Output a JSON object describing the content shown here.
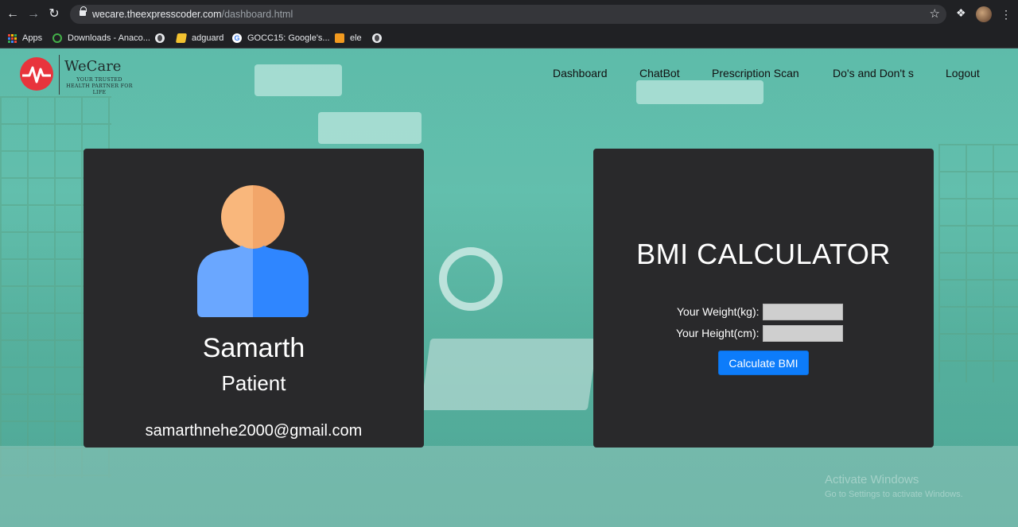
{
  "browser": {
    "url_host": "wecare.theexpresscoder.com",
    "url_path": "/dashboard.html",
    "bookmarks": [
      {
        "label": "Apps",
        "icon": "apps-grid-icon"
      },
      {
        "label": "Downloads - Anaco...",
        "icon": "anaconda-icon"
      },
      {
        "label": "",
        "icon": "globe-icon"
      },
      {
        "label": "adguard",
        "icon": "adguard-icon"
      },
      {
        "label": "GOCC15: Google's...",
        "icon": "google-icon"
      },
      {
        "label": "ele",
        "icon": "ele-icon"
      },
      {
        "label": "",
        "icon": "globe-icon"
      }
    ]
  },
  "brand": {
    "name": "WeCare",
    "tagline": "Your Trusted Health Partner For Life",
    "logo_color": "#e8343c"
  },
  "nav": {
    "items": [
      "Dashboard",
      "ChatBot",
      "Prescription Scan",
      "Do's and Don't s",
      "Logout"
    ]
  },
  "profile": {
    "name": "Samarth",
    "role": "Patient",
    "email": "samarthnehe2000@gmail.com"
  },
  "bmi": {
    "title": "BMI CALCULATOR",
    "weight_label": "Your Weight(kg):",
    "height_label": "Your Height(cm):",
    "weight_value": "",
    "height_value": "",
    "button_label": "Calculate BMI",
    "button_color": "#0d7cfa"
  },
  "system": {
    "watermark_title": "Activate Windows",
    "watermark_sub": "Go to Settings to activate Windows."
  }
}
